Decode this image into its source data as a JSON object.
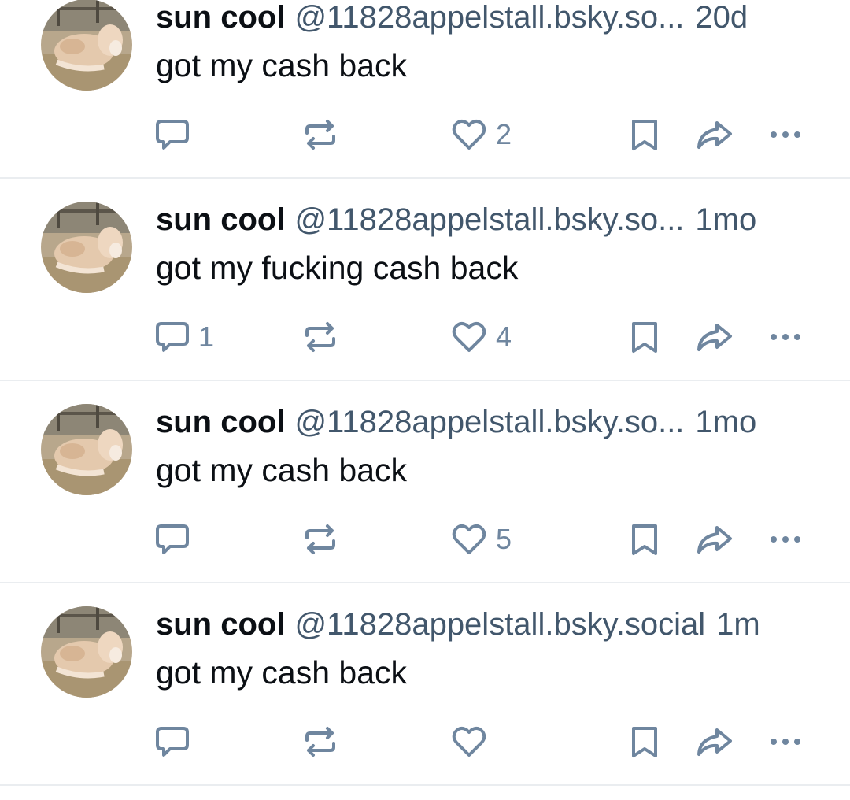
{
  "colors": {
    "text": "#0b0f14",
    "muted": "#42576c",
    "icon": "#6f869f",
    "divider": "#eaedf0"
  },
  "icons": {
    "reply": "speech-bubble-icon",
    "repost": "repost-arrows-icon",
    "like": "heart-icon",
    "save": "bookmark-icon",
    "share": "share-arrow-icon",
    "more": "ellipsis-icon"
  },
  "posts": [
    {
      "name": "sun cool",
      "handle": "@11828appelstall.bsky.so...",
      "time": "20d",
      "text": "got my cash back",
      "replies": "",
      "reposts": "",
      "likes": "2"
    },
    {
      "name": "sun cool",
      "handle": "@11828appelstall.bsky.so...",
      "time": "1mo",
      "text": "got my fucking cash back",
      "replies": "1",
      "reposts": "",
      "likes": "4"
    },
    {
      "name": "sun cool",
      "handle": "@11828appelstall.bsky.so...",
      "time": "1mo",
      "text": "got my cash back",
      "replies": "",
      "reposts": "",
      "likes": "5"
    },
    {
      "name": "sun cool",
      "handle": "@11828appelstall.bsky.social",
      "time": "1m",
      "text": "got my cash back",
      "replies": "",
      "reposts": "",
      "likes": ""
    }
  ]
}
